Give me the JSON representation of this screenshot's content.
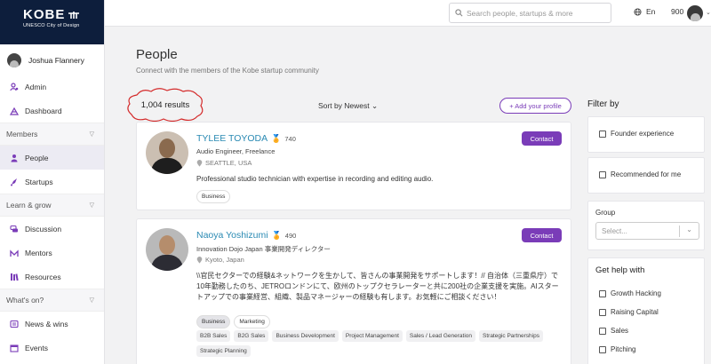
{
  "brand": {
    "name": "KOBE",
    "tagline": "UNESCO City of Design"
  },
  "user": {
    "name": "Joshua Flannery"
  },
  "sidebar": {
    "top_items": [
      {
        "label": "Admin",
        "icon": "admin-icon"
      },
      {
        "label": "Dashboard",
        "icon": "dashboard-icon"
      }
    ],
    "sections": [
      {
        "label": "Members",
        "items": [
          {
            "label": "People",
            "active": true
          },
          {
            "label": "Startups"
          }
        ]
      },
      {
        "label": "Learn & grow",
        "items": [
          {
            "label": "Discussion"
          },
          {
            "label": "Mentors"
          },
          {
            "label": "Resources"
          }
        ]
      },
      {
        "label": "What's on?",
        "items": [
          {
            "label": "News & wins"
          },
          {
            "label": "Events"
          }
        ]
      }
    ]
  },
  "topbar": {
    "search_placeholder": "Search people, startups & more",
    "language": "En",
    "points": "900"
  },
  "page": {
    "title": "People",
    "subtitle": "Connect with the members of the Kobe startup community",
    "results": "1,004 results",
    "sort": "Sort by Newest",
    "add_profile": "+ Add your profile"
  },
  "people": [
    {
      "name": "TYLEE TOYODA",
      "score": "740",
      "role": "Audio Engineer, Freelance",
      "location": "SEATTLE, USA",
      "bio": "Professional studio technician with expertise in recording and editing audio.",
      "tags": [
        "Business"
      ],
      "contact": "Contact"
    },
    {
      "name": "Naoya Yoshizumi",
      "score": "490",
      "role": "Innovation Dojo Japan 事業開発ディレクター",
      "location": "Kyoto, Japan",
      "bio": "\\\\官民セクターでの経験&ネットワークを生かして、皆さんの事業開発をサポートします！// 自治体（三重県庁）で10年勤務したのち、JETROロンドンにて、欧州のトップクセラレーターと共に200社の企業支援を実施。AIスタートアップでの事業経営、組織、製品マネージャーの経験も有します。お気軽にご相談ください！",
      "tags": [
        "Business",
        "Marketing"
      ],
      "skills": [
        "B2B Sales",
        "B2G Sales",
        "Business Development",
        "Project Management",
        "Sales / Lead Generation",
        "Strategic Partnerships",
        "Strategic Planning"
      ],
      "contact": "Contact"
    }
  ],
  "filter": {
    "title": "Filter by",
    "founder": "Founder experience",
    "recommended": "Recommended for me",
    "group_label": "Group",
    "group_placeholder": "Select...",
    "help_title": "Get help with",
    "help_items": [
      "Growth Hacking",
      "Raising Capital",
      "Sales",
      "Pitching"
    ]
  },
  "colors": {
    "accent": "#7a3cb8",
    "brand_bg": "#0d1e3c",
    "link": "#2a8ab3"
  }
}
